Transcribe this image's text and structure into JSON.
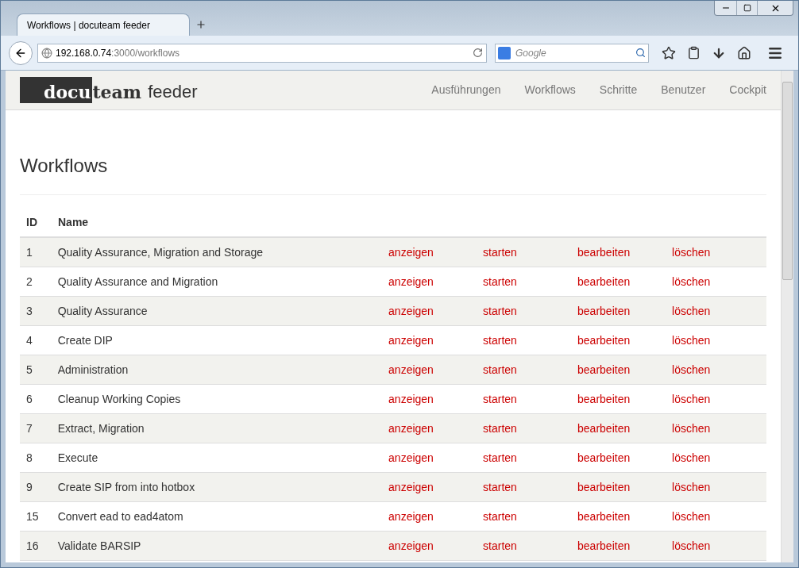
{
  "browser": {
    "tab_title": "Workflows | docuteam feeder",
    "url_host": "192.168.0.74",
    "url_path": ":3000/workflows",
    "search_placeholder": "Google"
  },
  "header": {
    "logo": {
      "dark_part": "docu",
      "bold_part": "team",
      "light_part": "feeder"
    },
    "nav": [
      {
        "label": "Ausführungen"
      },
      {
        "label": "Workflows"
      },
      {
        "label": "Schritte"
      },
      {
        "label": "Benutzer"
      },
      {
        "label": "Cockpit"
      }
    ]
  },
  "page_title": "Workflows",
  "table": {
    "columns": [
      "ID",
      "Name"
    ],
    "rows": [
      {
        "id": "1",
        "name": "Quality Assurance, Migration and Storage",
        "actions": [
          "anzeigen",
          "starten",
          "bearbeiten",
          "löschen"
        ]
      },
      {
        "id": "2",
        "name": "Quality Assurance and Migration",
        "actions": [
          "anzeigen",
          "starten",
          "bearbeiten",
          "löschen"
        ]
      },
      {
        "id": "3",
        "name": "Quality Assurance",
        "actions": [
          "anzeigen",
          "starten",
          "bearbeiten",
          "löschen"
        ]
      },
      {
        "id": "4",
        "name": "Create DIP",
        "actions": [
          "anzeigen",
          "starten",
          "bearbeiten",
          "löschen"
        ]
      },
      {
        "id": "5",
        "name": "Administration",
        "actions": [
          "anzeigen",
          "starten",
          "bearbeiten",
          "löschen"
        ]
      },
      {
        "id": "6",
        "name": "Cleanup Working Copies",
        "actions": [
          "anzeigen",
          "starten",
          "bearbeiten",
          "löschen"
        ]
      },
      {
        "id": "7",
        "name": "Extract, Migration",
        "actions": [
          "anzeigen",
          "starten",
          "bearbeiten",
          "löschen"
        ]
      },
      {
        "id": "8",
        "name": "Execute",
        "actions": [
          "anzeigen",
          "starten",
          "bearbeiten",
          "löschen"
        ]
      },
      {
        "id": "9",
        "name": "Create SIP from into hotbox",
        "actions": [
          "anzeigen",
          "starten",
          "bearbeiten",
          "löschen"
        ]
      },
      {
        "id": "15",
        "name": "Convert ead to ead4atom",
        "actions": [
          "anzeigen",
          "starten",
          "bearbeiten",
          "löschen"
        ]
      },
      {
        "id": "16",
        "name": "Validate BARSIP",
        "actions": [
          "anzeigen",
          "starten",
          "bearbeiten",
          "löschen"
        ]
      }
    ]
  }
}
